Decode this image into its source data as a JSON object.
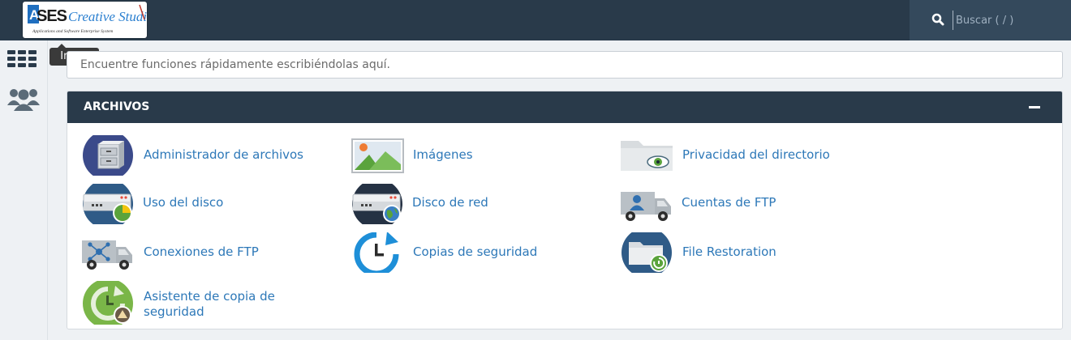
{
  "topbar": {
    "logo_text": "SES Creative Studio",
    "logo_tagline": "Applications and Software Enterprise System",
    "search_placeholder": "Buscar ( / )"
  },
  "sidebar": {
    "home_tooltip": "Inicio"
  },
  "quickfind": {
    "placeholder": "Encuentre funciones rápidamente escribiéndolas aquí."
  },
  "panel": {
    "title": "ARCHIVOS",
    "items": [
      {
        "label": "Administrador de archivos",
        "icon": "file-manager-icon"
      },
      {
        "label": "Imágenes",
        "icon": "images-icon"
      },
      {
        "label": "Privacidad del directorio",
        "icon": "directory-privacy-icon"
      },
      {
        "label": "Uso del disco",
        "icon": "disk-usage-icon"
      },
      {
        "label": "Disco de red",
        "icon": "web-disk-icon"
      },
      {
        "label": "Cuentas de FTP",
        "icon": "ftp-accounts-icon"
      },
      {
        "label": "Conexiones de FTP",
        "icon": "ftp-connections-icon"
      },
      {
        "label": "Copias de seguridad",
        "icon": "backup-icon"
      },
      {
        "label": "File Restoration",
        "icon": "file-restoration-icon"
      },
      {
        "label": "Asistente de copia de seguridad",
        "label_line1": "Asistente de copia de",
        "label_line2": "seguridad",
        "icon": "backup-wizard-icon"
      }
    ]
  },
  "colors": {
    "topbar": "#293a4a",
    "link": "#2d78b8",
    "accent_green": "#5aa33c"
  }
}
